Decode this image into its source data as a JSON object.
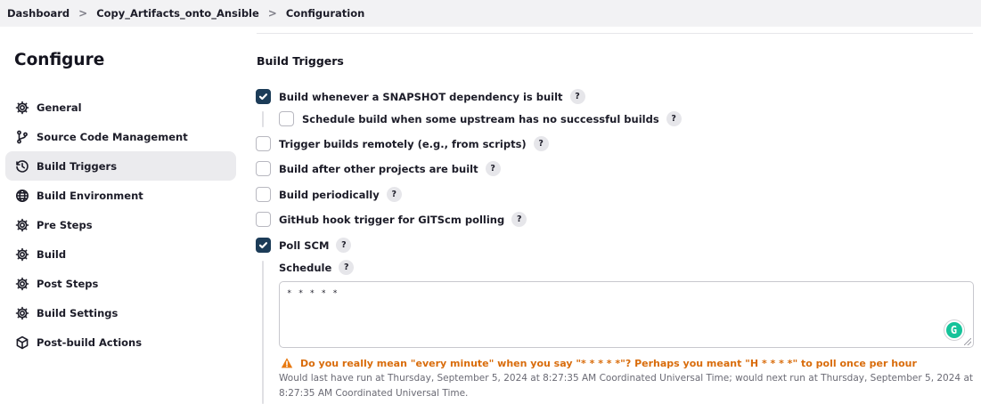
{
  "breadcrumb": {
    "items": [
      "Dashboard",
      "Copy_Artifacts_onto_Ansible",
      "Configuration"
    ],
    "separator": ">"
  },
  "sidebar": {
    "title": "Configure",
    "items": [
      {
        "label": "General",
        "icon": "gear-icon"
      },
      {
        "label": "Source Code Management",
        "icon": "git-branch-icon"
      },
      {
        "label": "Build Triggers",
        "icon": "clock-icon",
        "active": true
      },
      {
        "label": "Build Environment",
        "icon": "globe-icon"
      },
      {
        "label": "Pre Steps",
        "icon": "gear-icon"
      },
      {
        "label": "Build",
        "icon": "gear-icon"
      },
      {
        "label": "Post Steps",
        "icon": "gear-icon"
      },
      {
        "label": "Build Settings",
        "icon": "gear-icon"
      },
      {
        "label": "Post-build Actions",
        "icon": "cube-icon"
      }
    ]
  },
  "main": {
    "section_title": "Build Triggers",
    "triggers": {
      "snapshot": {
        "label": "Build whenever a SNAPSHOT dependency is built",
        "checked": true
      },
      "upstream_failed": {
        "label": "Schedule build when some upstream has no successful builds",
        "checked": false
      },
      "remote": {
        "label": "Trigger builds remotely (e.g., from scripts)",
        "checked": false
      },
      "after_other": {
        "label": "Build after other projects are built",
        "checked": false
      },
      "periodically": {
        "label": "Build periodically",
        "checked": false
      },
      "github_hook": {
        "label": "GitHub hook trigger for GITScm polling",
        "checked": false
      },
      "poll_scm": {
        "label": "Poll SCM",
        "checked": true
      }
    },
    "help_glyph": "?",
    "schedule": {
      "label": "Schedule",
      "value": "* * * * *"
    },
    "grammarly_glyph": "G",
    "warning_text": "Do you really mean \"every minute\" when you say \"* * * * *\"? Perhaps you meant \"H * * * *\" to poll once per hour",
    "info_text": "Would last have run at Thursday, September 5, 2024 at 8:27:35 AM Coordinated Universal Time; would next run at Thursday, September 5, 2024 at 8:27:35 AM Coordinated Universal Time."
  },
  "colors": {
    "checkbox_checked": "#1c3c58",
    "warning": "#d96c0b",
    "active_nav_bg": "#ebebee"
  }
}
